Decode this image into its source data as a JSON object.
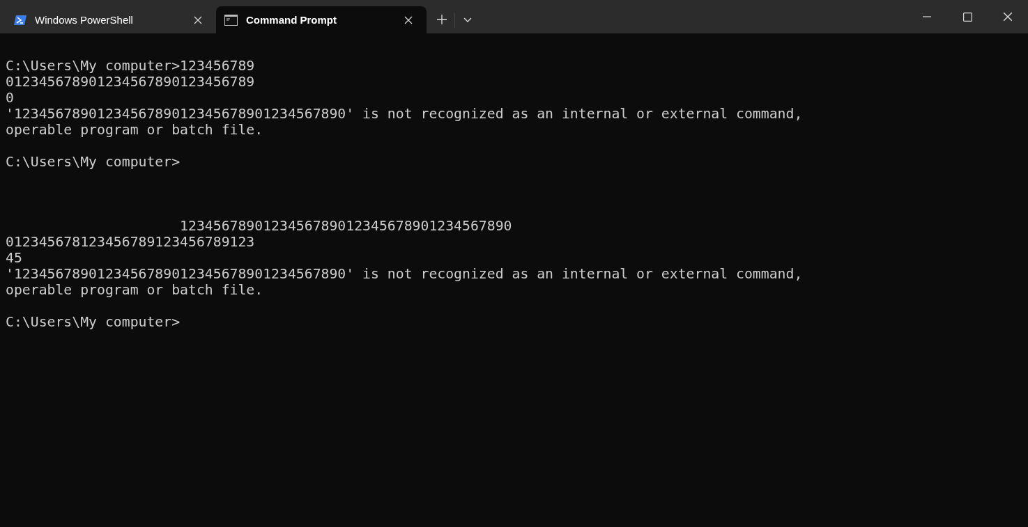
{
  "tabs": [
    {
      "title": "Windows PowerShell",
      "kind": "powershell",
      "selected": false
    },
    {
      "title": "Command Prompt",
      "kind": "cmd",
      "selected": true
    }
  ],
  "terminal": {
    "blocks": [
      {
        "lines": [
          "C:\\Users\\My computer>123456789",
          "012345678901234567890123456789",
          "0",
          "'1234567890123456789012345678901234567890' is not recognized as an internal or external command,",
          "operable program or batch file."
        ]
      },
      {
        "lines": [
          "C:\\Users\\My computer>"
        ]
      },
      {
        "lines": [
          "                     1234567890123456789012345678901234567890",
          "012345678123456789123456789123",
          "45",
          "'1234567890123456789012345678901234567890' is not recognized as an internal or external command,",
          "operable program or batch file."
        ]
      },
      {
        "lines": [
          "C:\\Users\\My computer>"
        ]
      }
    ]
  }
}
